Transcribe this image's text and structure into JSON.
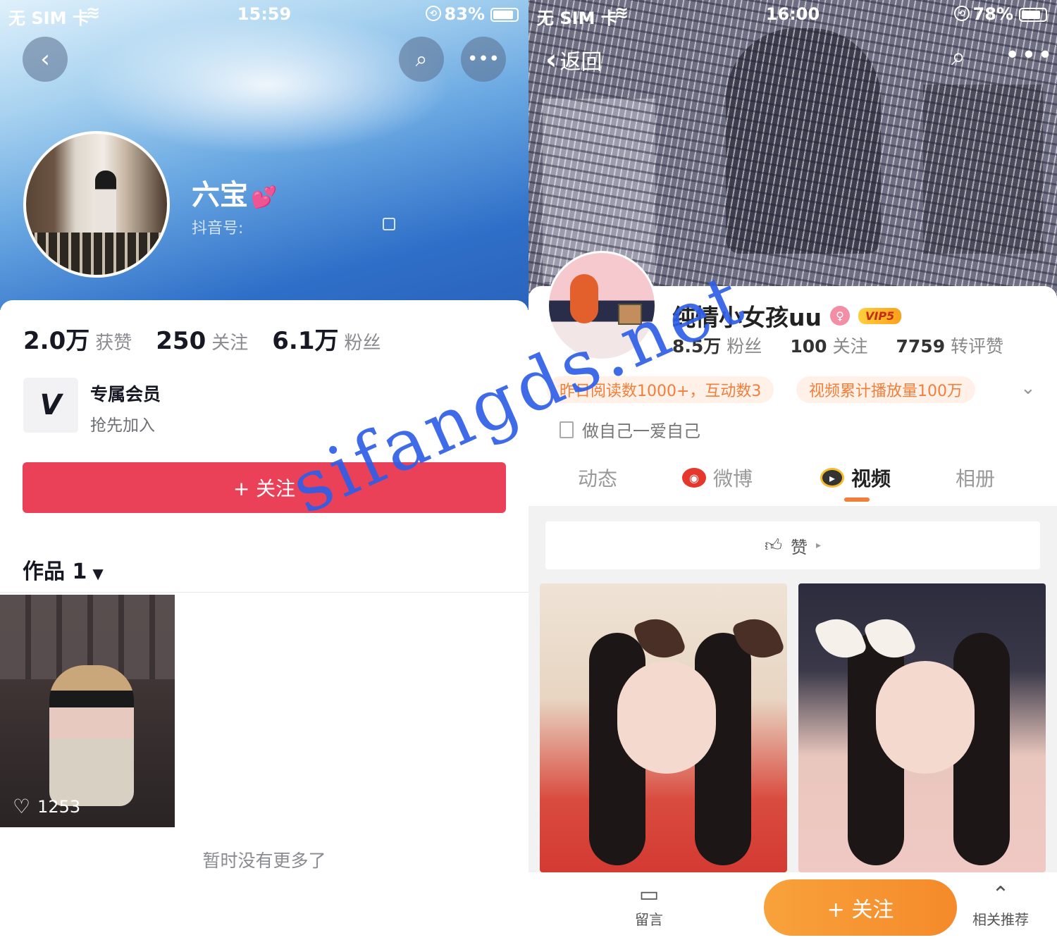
{
  "left": {
    "status": {
      "carrier": "无 SIM 卡",
      "time": "15:59",
      "battery": "83%"
    },
    "profile": {
      "name": "六宝",
      "name_emoji": "💕",
      "id_label": "抖音号:"
    },
    "stats": [
      {
        "num": "2.0万",
        "label": "获赞"
      },
      {
        "num": "250",
        "label": "关注"
      },
      {
        "num": "6.1万",
        "label": "粉丝"
      }
    ],
    "membership": {
      "title": "专属会员",
      "subtitle": "抢先加入",
      "icon": "V"
    },
    "follow_label": "+ 关注",
    "works_label": "作品 1",
    "video_likes": "1253",
    "no_more": "暂时没有更多了"
  },
  "right": {
    "status": {
      "carrier": "无 SIM 卡",
      "time": "16:00",
      "battery": "78%"
    },
    "back_label": "返回",
    "profile": {
      "name": "纯情小女孩uu",
      "vip": "VIP5"
    },
    "stats": [
      {
        "num": "8.5万",
        "label": "粉丝"
      },
      {
        "num": "100",
        "label": "关注"
      },
      {
        "num": "7759",
        "label": "转评赞"
      }
    ],
    "chips": [
      "昨日阅读数1000+，互动数3",
      "视频累计播放量100万"
    ],
    "bio": "做自己一爱自己",
    "tabs": [
      "动态",
      "微博",
      "视频",
      "相册"
    ],
    "active_tab": "视频",
    "like_bar": "赞",
    "bottom": {
      "comment": "留言",
      "follow": "+ 关注",
      "recommend": "相关推荐"
    }
  },
  "watermark": "sifangds.net",
  "colors": {
    "douyin_red": "#ea4158",
    "weibo_orange": "#f58a2a"
  }
}
